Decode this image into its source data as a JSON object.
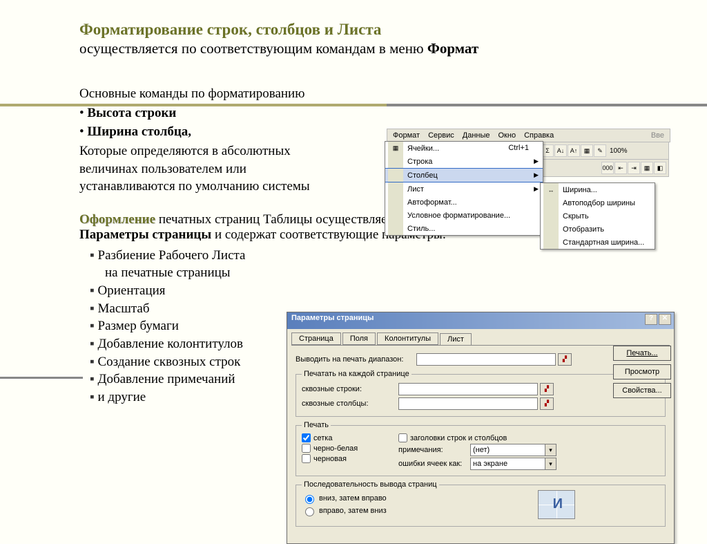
{
  "title": "Форматирование строк, столбцов и Листа",
  "subtitle_plain": "осуществляется   по соответствующим командам в меню ",
  "subtitle_bold": "Формат",
  "section1": {
    "intro": "Основные команды по форматированию",
    "b1": "Высота строки",
    "b2": "Ширина столбца,",
    "rest": "Которые определяются в абсолютных величинах пользователем или устанавливаются по умолчанию системы"
  },
  "menubar": [
    "Формат",
    "Сервис",
    "Данные",
    "Окно",
    "Справка"
  ],
  "toolbar_tail": "Вве",
  "zoom": "100%",
  "menu": {
    "cells": "Ячейки...",
    "cells_shortcut": "Ctrl+1",
    "row": "Строка",
    "column": "Столбец",
    "sheet": "Лист",
    "autoformat": "Автоформат...",
    "condfmt": "Условное форматирование...",
    "style": "Стиль..."
  },
  "submenu": {
    "width": "Ширина...",
    "autofit": "Автоподбор ширины",
    "hide": "Скрыть",
    "unhide": "Отобразить",
    "stdwidth": "Стандартная ширина..."
  },
  "section2": {
    "ofrm": "Оформление",
    "tail1": "  печатных страниц Таблицы осуществляется с помощью команды",
    "params_bold": "Параметры страницы",
    "tail2": " и содержат соответствующие параметры:"
  },
  "params": [
    "Разбиение Рабочего Листа",
    "   на печатные страницы",
    "Ориентация",
    "Масштаб",
    "Размер бумаги",
    "Добавление колонтитулов",
    "Создание сквозных строк",
    "Добавление примечаний",
    "и другие"
  ],
  "dialog": {
    "title": "Параметры страницы",
    "tabs": [
      "Страница",
      "Поля",
      "Колонтитулы",
      "Лист"
    ],
    "print_range": "Выводить на печать диапазон:",
    "each_page_group": "Печатать на каждой странице",
    "through_rows": "сквозные строки:",
    "through_cols": "сквозные столбцы:",
    "print_group": "Печать",
    "grid": "сетка",
    "bw": "черно-белая",
    "draft": "черновая",
    "headings": "заголовки строк и столбцов",
    "notes_lbl": "примечания:",
    "notes_val": "(нет)",
    "errors_lbl": "ошибки ячеек как:",
    "errors_val": "на экране",
    "order_group": "Последовательность вывода страниц",
    "order_down": "вниз, затем вправо",
    "order_right": "вправо, затем вниз",
    "btn_print": "Печать...",
    "btn_preview": "Просмотр",
    "btn_props": "Свойства..."
  }
}
